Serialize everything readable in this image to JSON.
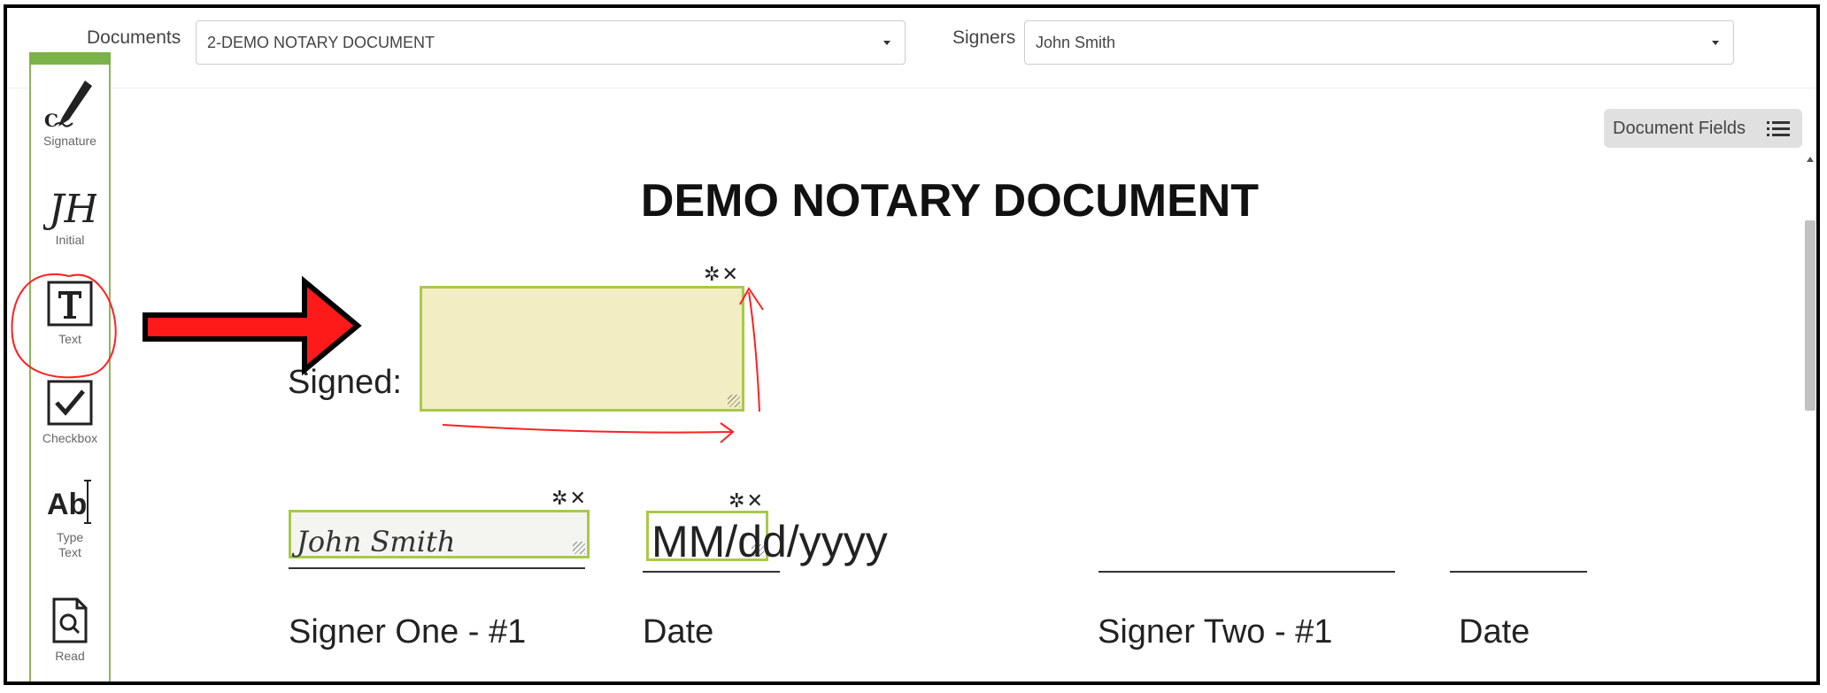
{
  "topbar": {
    "documents_label": "Documents",
    "documents_value": "2-DEMO NOTARY DOCUMENT",
    "signers_label": "Signers",
    "signers_value": "John Smith"
  },
  "toolbar": {
    "items": [
      {
        "label": "Signature",
        "icon": "signature-pen-icon"
      },
      {
        "label": "Initial",
        "icon": "initial-icon"
      },
      {
        "label": "Text",
        "icon": "text-icon"
      },
      {
        "label": "Checkbox",
        "icon": "checkbox-icon"
      },
      {
        "label": "Type Text",
        "icon": "type-text-icon"
      },
      {
        "label": "Read",
        "icon": "read-doc-icon"
      }
    ]
  },
  "document_fields_button": {
    "label": "Document Fields"
  },
  "document": {
    "title": "DEMO NOTARY DOCUMENT",
    "signed_label": "Signed:",
    "signer_one_label": "Signer One - #1",
    "date_label_1": "Date",
    "signer_two_label": "Signer Two - #1",
    "date_label_2": "Date",
    "signature_value": "John Smith",
    "date_placeholder": "MM/dd/yyyy"
  },
  "colors": {
    "accent_green": "#7bb24a",
    "field_fill": "#f2edc2",
    "field_border": "#a8c94a",
    "annotation_red": "#ff0000"
  }
}
